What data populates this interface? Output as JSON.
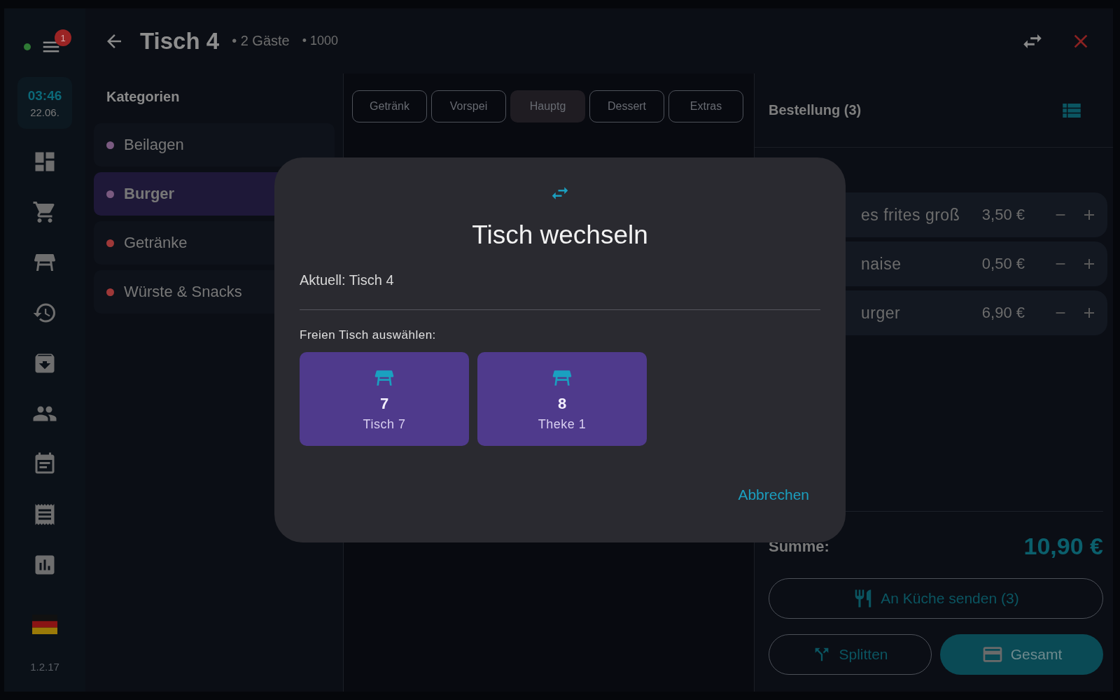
{
  "sidebar": {
    "menu_badge": "1",
    "time": "03:46",
    "date": "22.06.",
    "version": "1.2.17"
  },
  "header": {
    "title": "Tisch 4",
    "guests": "• 2 Gäste",
    "code": "• 1000"
  },
  "categories": {
    "title": "Kategorien",
    "items": [
      {
        "label": "Beilagen",
        "color": "#7a5a80",
        "selected": false
      },
      {
        "label": "Burger",
        "color": "#7a5a80",
        "selected": true
      },
      {
        "label": "Getränke",
        "color": "#9e3838",
        "selected": false
      },
      {
        "label": "Würste & Snacks",
        "color": "#9e3838",
        "selected": false
      }
    ]
  },
  "product_tabs": [
    {
      "label": "Getränk",
      "selected": false
    },
    {
      "label": "Vorspei",
      "selected": false
    },
    {
      "label": "Hauptg",
      "selected": true
    },
    {
      "label": "Dessert",
      "selected": false
    },
    {
      "label": "Extras",
      "selected": false
    }
  ],
  "order": {
    "title": "Bestellung (3)",
    "items": [
      {
        "name": "es frites groß",
        "price": "3,50 €"
      },
      {
        "name": "naise",
        "price": "0,50 €"
      },
      {
        "name": "urger",
        "price": "6,90 €"
      }
    ],
    "sum_label": "Summe:",
    "total": "10,90 €",
    "send_button": "An Küche senden (3)",
    "split_button": "Splitten",
    "pay_button": "Gesamt"
  },
  "dialog": {
    "title": "Tisch wechseln",
    "current": "Aktuell: Tisch 4",
    "prompt": "Freien Tisch auswählen:",
    "tables": [
      {
        "number": "7",
        "name": "Tisch 7"
      },
      {
        "number": "8",
        "name": "Theke 1"
      }
    ],
    "cancel": "Abbrechen"
  }
}
